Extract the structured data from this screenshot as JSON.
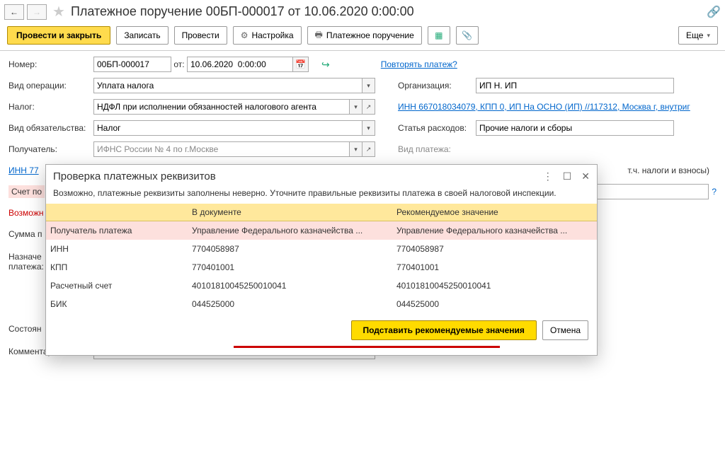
{
  "header": {
    "title": "Платежное поручение 00БП-000017 от 10.06.2020 0:00:00"
  },
  "toolbar": {
    "submit": "Провести и закрыть",
    "save": "Записать",
    "post": "Провести",
    "settings": "Настройка",
    "print": "Платежное поручение",
    "more": "Еще"
  },
  "form": {
    "number_label": "Номер:",
    "number": "00БП-000017",
    "from_label": "от:",
    "date": "10.06.2020  0:00:00",
    "repeat_link": "Повторять платеж?",
    "optype_label": "Вид операции:",
    "optype": "Уплата налога",
    "org_label": "Организация:",
    "org": "ИП Н. ИП",
    "tax_label": "Налог:",
    "tax": "НДФЛ при исполнении обязанностей налогового агента",
    "org_link": "ИНН 667018034079, КПП 0, ИП На ОСНО (ИП) //117312, Москва г, внутриг",
    "obl_label": "Вид обязательства:",
    "obl": "Налог",
    "exp_label": "Статья расходов:",
    "exp": "Прочие налоги и сборы",
    "recv_label": "Получатель:",
    "recv": "ИФНС России № 4 по г.Москве",
    "paytype_label": "Вид платежа:",
    "inn77_link": "ИНН 77",
    "tax_note_tail": "т.ч. налоги и взносы)",
    "account_label": "Счет по",
    "possible": "Возможн",
    "sum_label": "Сумма п",
    "purpose_label": "Назначе",
    "purpose_label2": "платежа:",
    "state_label": "Состоян",
    "comments_label": "Комментарии:"
  },
  "modal": {
    "title": "Проверка платежных реквизитов",
    "message": "Возможно, платежные реквизиты заполнены неверно. Уточните правильные реквизиты платежа в своей налоговой инспекции.",
    "col_doc": "В документе",
    "col_rec": "Рекомендуемое значение",
    "rows": [
      {
        "name": "Получатель платежа",
        "doc": "Управление Федерального казначейства ...",
        "rec": "Управление Федерального казначейства ..."
      },
      {
        "name": "ИНН",
        "doc": "7704058987",
        "rec": "7704058987"
      },
      {
        "name": "КПП",
        "doc": "770401001",
        "rec": "770401001"
      },
      {
        "name": "Расчетный счет",
        "doc": "40101810045250010041",
        "rec": "40101810045250010041"
      },
      {
        "name": "БИК",
        "doc": "044525000",
        "rec": "044525000"
      }
    ],
    "apply": "Подставить рекомендуемые значения",
    "cancel": "Отмена"
  }
}
